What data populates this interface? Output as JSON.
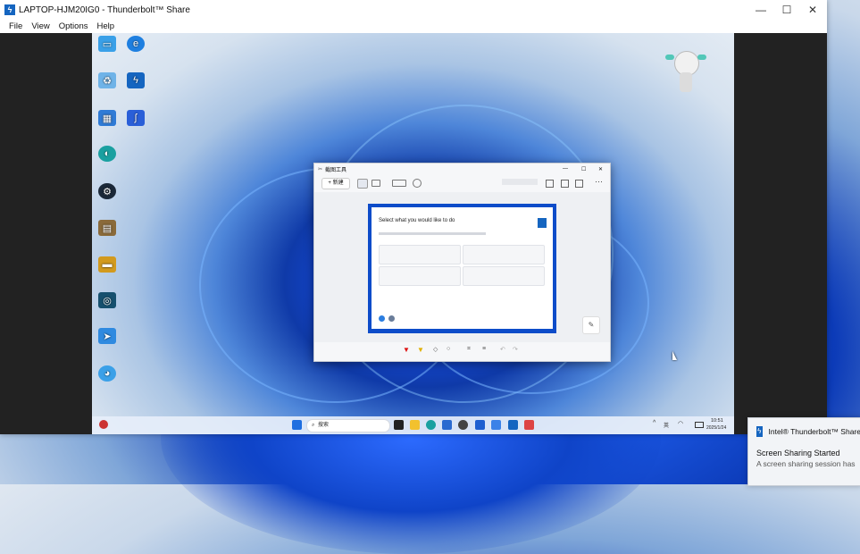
{
  "window": {
    "title": "LAPTOP-HJM20IG0 - Thunderbolt™ Share",
    "controls": {
      "minimize": "—",
      "maximize": "☐",
      "close": "✕"
    }
  },
  "menubar": {
    "items": [
      "File",
      "View",
      "Options",
      "Help"
    ]
  },
  "remote_desktop": {
    "icons": [
      "",
      "",
      "",
      "",
      "",
      "",
      "",
      "",
      "",
      "",
      "",
      "",
      "",
      ""
    ],
    "snipping_tool": {
      "title": "截图工具",
      "new_label": "+ 新建",
      "inner_dialog": {
        "heading": "Select what you would like to do",
        "cards": [
          "",
          "",
          "",
          ""
        ]
      }
    },
    "taskbar": {
      "search_placeholder": "搜索",
      "time": "10:51",
      "date": "2025/1/24",
      "lang": "英"
    }
  },
  "toast": {
    "app": "Intel® Thunderbolt™ Share",
    "title": "Screen Sharing Started",
    "body": "A screen sharing session has"
  },
  "colors": {
    "accent": "#1565c0",
    "desktop_blue": "#1447d6"
  }
}
